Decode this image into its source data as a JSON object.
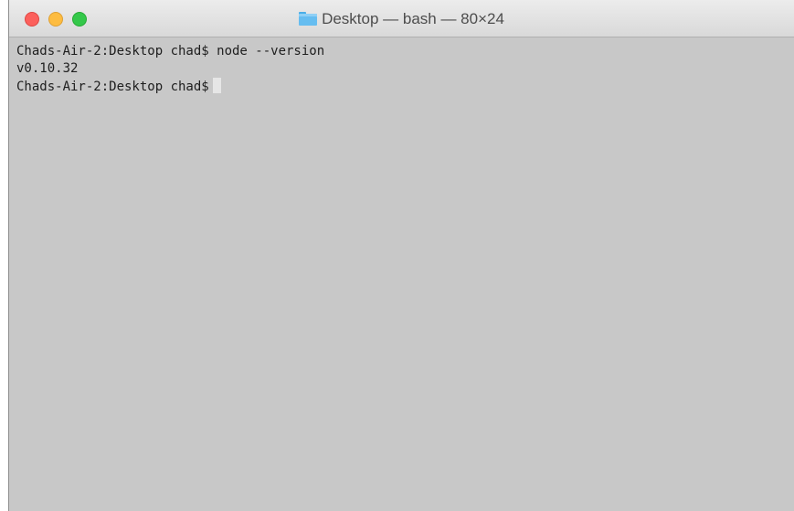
{
  "window": {
    "title": "Desktop — bash — 80×24",
    "title_icon": "folder-icon",
    "traffic_lights": {
      "close_color": "#fc605c",
      "minimize_color": "#fdbc40",
      "maximize_color": "#34c84a"
    },
    "background_color": "#c8c8c8"
  },
  "terminal": {
    "lines": [
      "Chads-Air-2:Desktop chad$ node --version",
      "v0.10.32"
    ],
    "prompt": "Chads-Air-2:Desktop chad$"
  }
}
